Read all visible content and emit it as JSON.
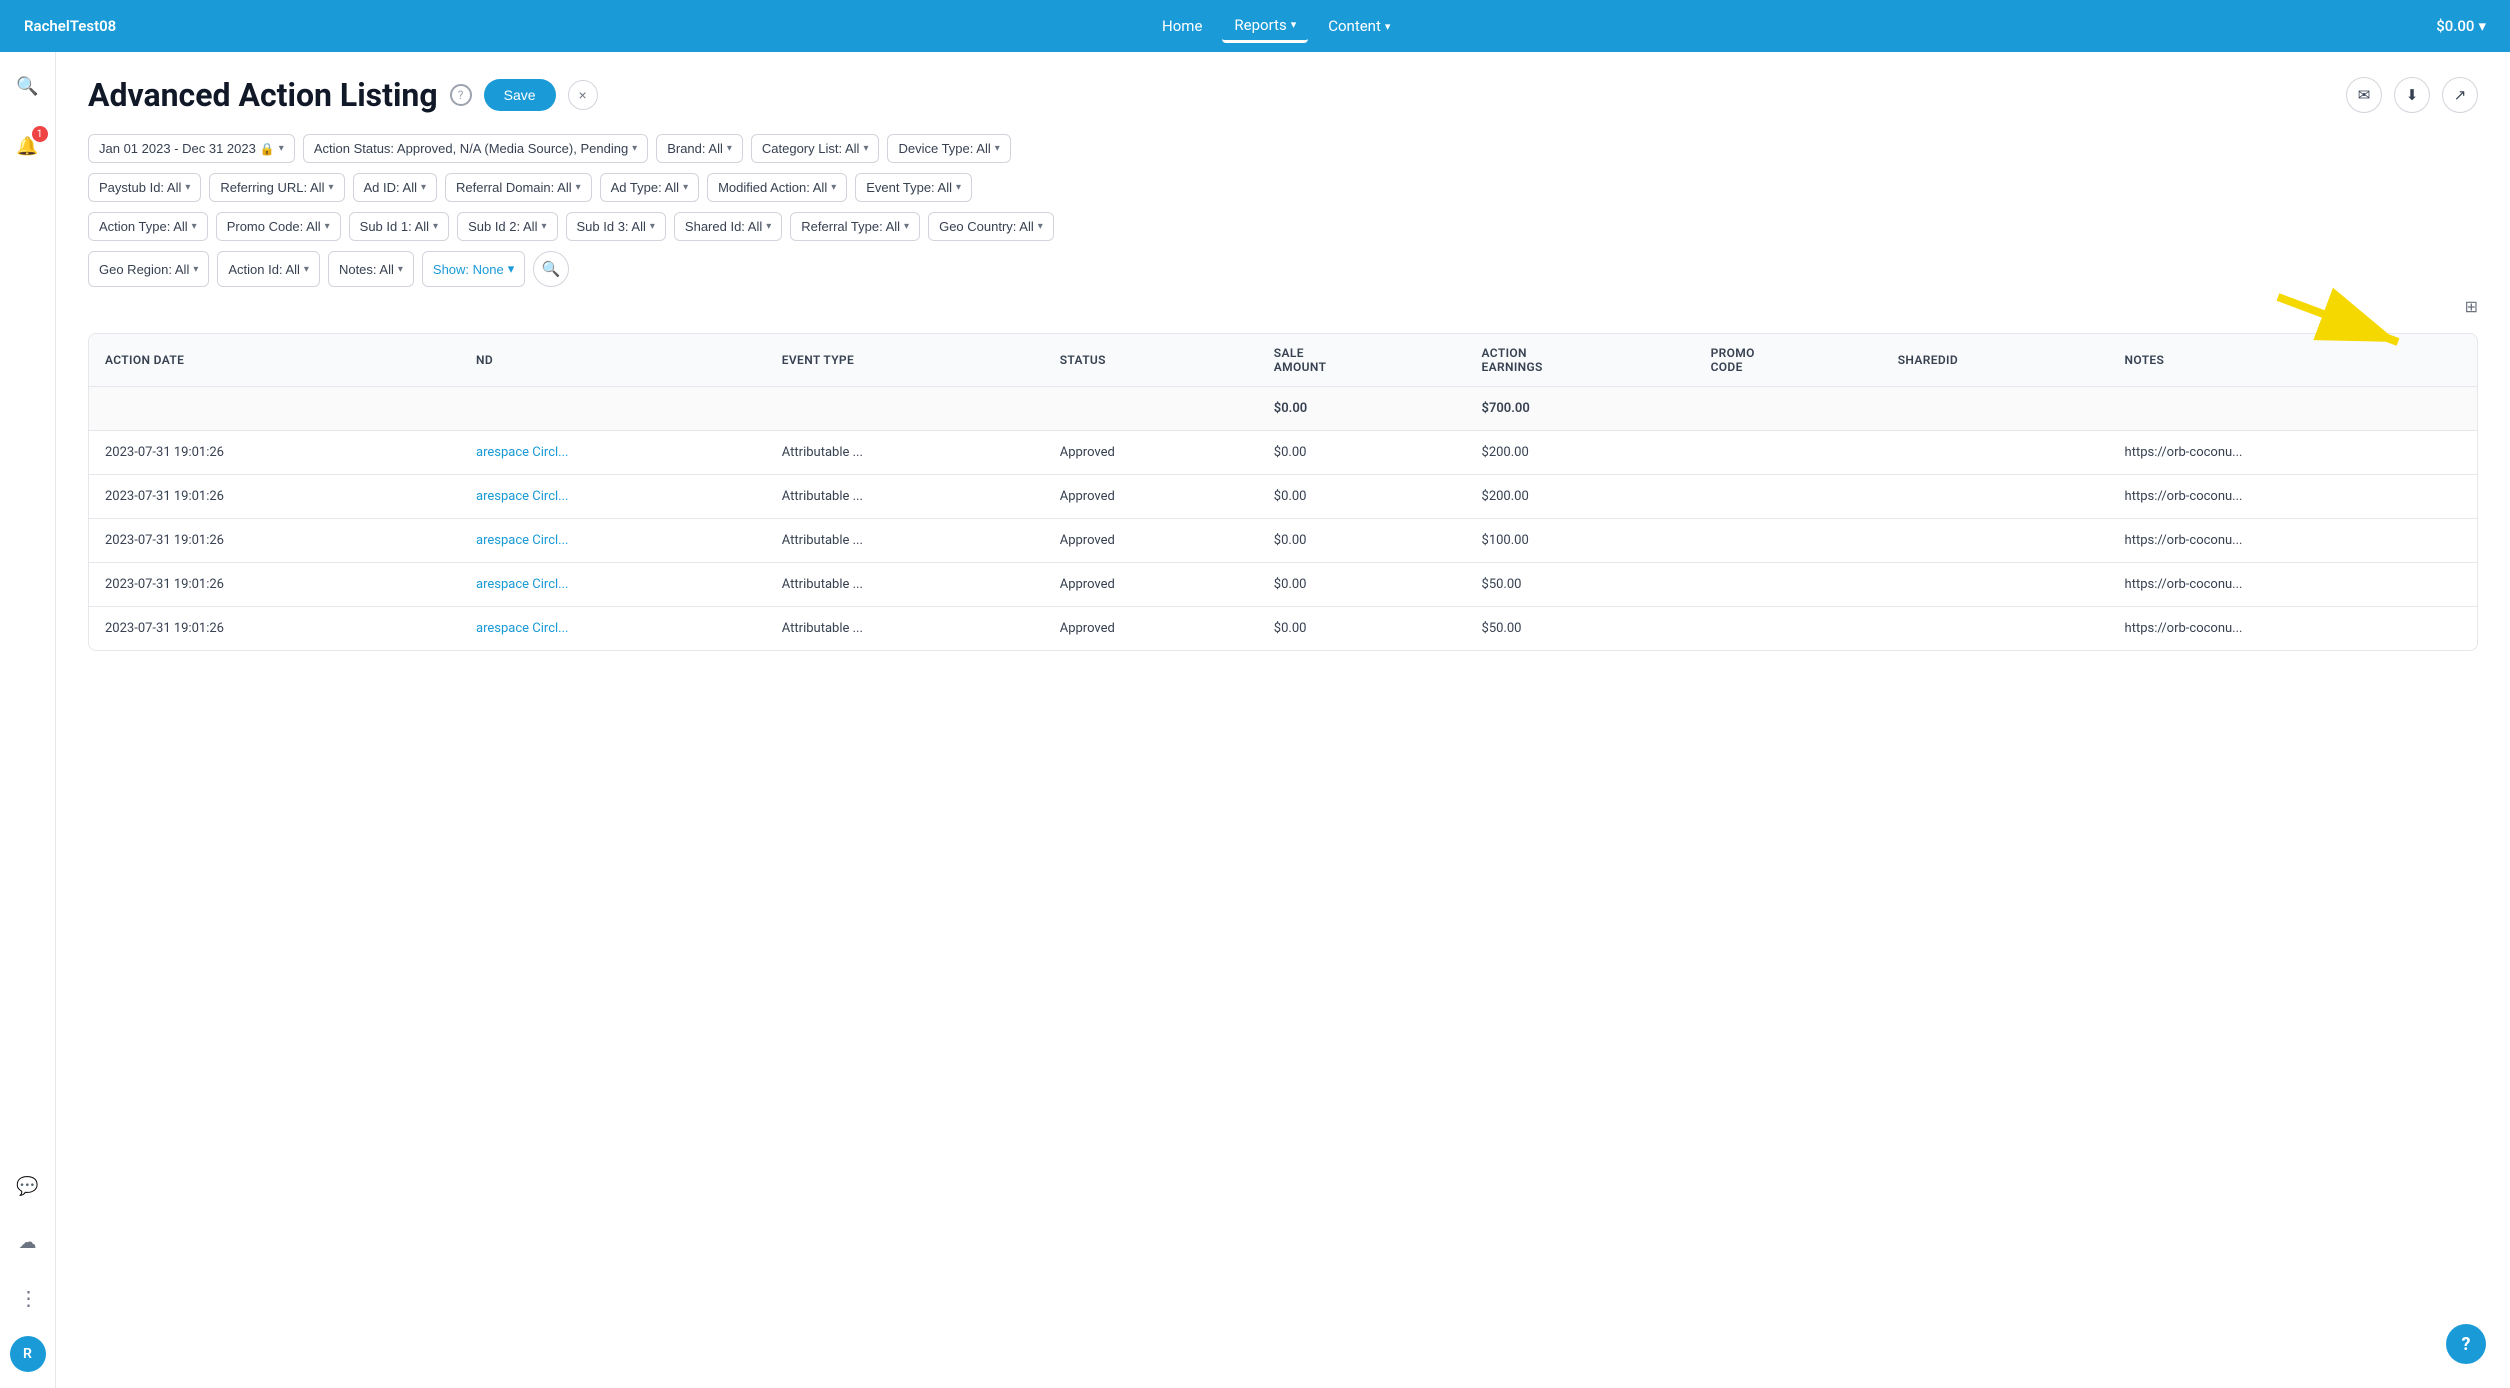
{
  "nav": {
    "brand": "RachelTest08",
    "links": [
      {
        "label": "Home",
        "active": false
      },
      {
        "label": "Reports",
        "active": true,
        "chevron": "▾"
      },
      {
        "label": "Content",
        "active": false,
        "chevron": "▾"
      }
    ],
    "balance": "$0.00",
    "balance_chevron": "▾"
  },
  "sidebar": {
    "search_icon": "🔍",
    "notification_icon": "🔔",
    "notification_count": "1",
    "chat_icon": "💬",
    "cloud_icon": "☁",
    "more_icon": "⋮",
    "avatar_label": "R"
  },
  "page": {
    "title": "Advanced Action Listing",
    "help_icon": "?",
    "save_label": "Save",
    "close_label": "×"
  },
  "header_actions": {
    "email_icon": "✉",
    "download_icon": "⬇",
    "share_icon": "↗"
  },
  "filters": {
    "row1": [
      {
        "label": "Jan 01 2023 - Dec 31 2023",
        "has_lock": true,
        "chevron": "▾"
      },
      {
        "label": "Action Status: Approved, N/A (Media Source), Pending",
        "chevron": "▾"
      },
      {
        "label": "Brand: All",
        "chevron": "▾"
      },
      {
        "label": "Category List: All",
        "chevron": "▾"
      },
      {
        "label": "Device Type: All",
        "chevron": "▾"
      }
    ],
    "row2": [
      {
        "label": "Paystub Id: All",
        "chevron": "▾"
      },
      {
        "label": "Referring URL: All",
        "chevron": "▾"
      },
      {
        "label": "Ad ID: All",
        "chevron": "▾"
      },
      {
        "label": "Referral Domain: All",
        "chevron": "▾"
      },
      {
        "label": "Ad Type: All",
        "chevron": "▾"
      },
      {
        "label": "Modified Action: All",
        "chevron": "▾"
      },
      {
        "label": "Event Type: All",
        "chevron": "▾"
      }
    ],
    "row3": [
      {
        "label": "Action Type: All",
        "chevron": "▾"
      },
      {
        "label": "Promo Code: All",
        "chevron": "▾"
      },
      {
        "label": "Sub Id 1: All",
        "chevron": "▾"
      },
      {
        "label": "Sub Id 2: All",
        "chevron": "▾"
      },
      {
        "label": "Sub Id 3: All",
        "chevron": "▾"
      },
      {
        "label": "Shared Id: All",
        "chevron": "▾"
      },
      {
        "label": "Referral Type: All",
        "chevron": "▾"
      },
      {
        "label": "Geo Country: All",
        "chevron": "▾"
      }
    ],
    "row4": [
      {
        "label": "Geo Region: All",
        "chevron": "▾"
      },
      {
        "label": "Action Id: All",
        "chevron": "▾"
      },
      {
        "label": "Notes: All",
        "chevron": "▾"
      }
    ],
    "show_label": "Show: None",
    "show_chevron": "▾",
    "search_icon": "🔍"
  },
  "table": {
    "columns": [
      "ACTION DATE",
      "ND",
      "EVENT TYPE",
      "STATUS",
      "SALE AMOUNT",
      "ACTION EARNINGS",
      "PROMO CODE",
      "SHAREDID",
      "NOTES"
    ],
    "totals_row": {
      "sale_amount": "$0.00",
      "action_earnings": "$700.00"
    },
    "rows": [
      {
        "action_date": "2023-07-31 19:01:26",
        "brand": "arespace Circl...",
        "event_type": "Attributable ...",
        "status": "Approved",
        "sale_amount": "$0.00",
        "action_earnings": "$200.00",
        "promo_code": "",
        "shared_id": "",
        "notes": "https://orb-coconu..."
      },
      {
        "action_date": "2023-07-31 19:01:26",
        "brand": "arespace Circl...",
        "event_type": "Attributable ...",
        "status": "Approved",
        "sale_amount": "$0.00",
        "action_earnings": "$200.00",
        "promo_code": "",
        "shared_id": "",
        "notes": "https://orb-coconu..."
      },
      {
        "action_date": "2023-07-31 19:01:26",
        "brand": "arespace Circl...",
        "event_type": "Attributable ...",
        "status": "Approved",
        "sale_amount": "$0.00",
        "action_earnings": "$100.00",
        "promo_code": "",
        "shared_id": "",
        "notes": "https://orb-coconu..."
      },
      {
        "action_date": "2023-07-31 19:01:26",
        "brand": "arespace Circl...",
        "event_type": "Attributable ...",
        "status": "Approved",
        "sale_amount": "$0.00",
        "action_earnings": "$50.00",
        "promo_code": "",
        "shared_id": "",
        "notes": "https://orb-coconu..."
      },
      {
        "action_date": "2023-07-31 19:01:26",
        "brand": "arespace Circl...",
        "event_type": "Attributable ...",
        "status": "Approved",
        "sale_amount": "$0.00",
        "action_earnings": "$50.00",
        "promo_code": "",
        "shared_id": "",
        "notes": "https://orb-coconu..."
      }
    ]
  },
  "help_fab": "?"
}
